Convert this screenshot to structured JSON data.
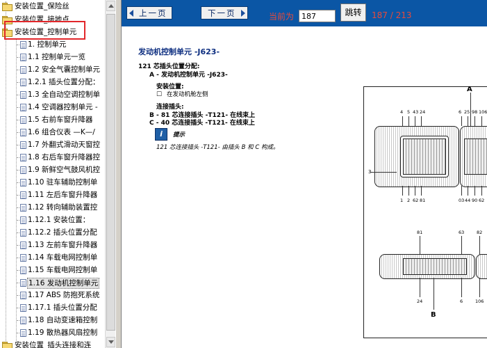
{
  "sidebar": {
    "items": [
      {
        "label": "安装位置_保险丝"
      },
      {
        "label": "安装位置_接地点"
      },
      {
        "label": "安装位置_控制单元"
      },
      {
        "label": "1. 控制单元"
      },
      {
        "label": "1.1 控制单元一览"
      },
      {
        "label": "1.2 安全气囊控制单元"
      },
      {
        "label": "1.2.1 插头位置分配："
      },
      {
        "label": "1.3 全自动空调控制单"
      },
      {
        "label": "1.4 空调器控制单元 -"
      },
      {
        "label": "1.5 右前车窗升降器"
      },
      {
        "label": "1.6 组合仪表 —K—/"
      },
      {
        "label": "1.7 外翻式滑动天窗控"
      },
      {
        "label": "1.8 右后车窗升降器控"
      },
      {
        "label": "1.9 新鲜空气鼓风机控"
      },
      {
        "label": "1.10 驻车辅助控制单"
      },
      {
        "label": "1.11 左后车窗升降器"
      },
      {
        "label": "1.12 转向辅助装置控"
      },
      {
        "label": "1.12.1 安装位置："
      },
      {
        "label": "1.12.2 插头位置分配"
      },
      {
        "label": "1.13 左前车窗升降器"
      },
      {
        "label": "1.14 车载电网控制单"
      },
      {
        "label": "1.15 车载电网控制单"
      },
      {
        "label": "1.16 发动机控制单元"
      },
      {
        "label": "1.17 ABS 防抱死系统"
      },
      {
        "label": "1.17.1 插头位置分配"
      },
      {
        "label": "1.18 自动变速箱控制"
      },
      {
        "label": "1.19 散热器风扇控制"
      },
      {
        "label": "安装位置_插头连接和连"
      }
    ]
  },
  "toolbar": {
    "prev_label": "上一页",
    "next_label": "下一页",
    "current_label": "当前为",
    "page_input_value": "187",
    "jump_label": "跳转",
    "page_count": "187 / 213"
  },
  "document": {
    "title": "发动机控制单元 -J623-",
    "lines": {
      "pin_assign": "121 芯插头位置分配:",
      "item_a": "A - 发动机控制单元 -J623-",
      "install_pos": "安装位置:",
      "install_detail": "在发动机舱左侧",
      "connector": "连接插头:",
      "b_line": "B - 81 芯连接插头 -T121- 在线束上",
      "c_line": "C - 40 芯连接插头 -T121- 在线束上",
      "tip": "提示",
      "tip_text": "121 芯连接插头 -T121- 由插头 B 和 C 构成。"
    }
  },
  "diagram": {
    "label_a": "A",
    "label_b": "B",
    "label_3": "3",
    "top_pins_left": [
      "4",
      "5",
      "43",
      "24"
    ],
    "top_pins_right": [
      "6",
      "25",
      "98",
      "106"
    ],
    "bottom_pins_left": [
      "1",
      "2",
      "62",
      "81"
    ],
    "bottom_pins_right": [
      "03",
      "44",
      "90",
      "62"
    ],
    "lower_top_left": "81",
    "lower_top_mid": "63",
    "lower_top_right": "82",
    "lower_bottom_left": "24",
    "lower_bottom_mid": "6",
    "lower_bottom_right": "106"
  }
}
